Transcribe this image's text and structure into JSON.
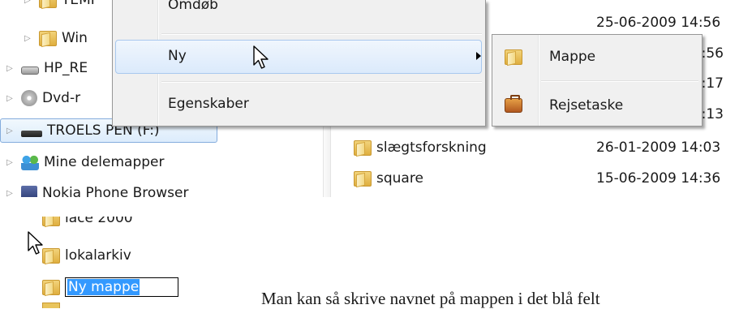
{
  "tree": {
    "items": [
      {
        "label": "TEMP",
        "icon": "folder-icon",
        "level": 2
      },
      {
        "label": "Win",
        "icon": "folder-icon",
        "level": 2
      },
      {
        "label": "HP_RE",
        "icon": "drive-icon",
        "level": 1
      },
      {
        "label": "Dvd-r",
        "icon": "dvd-drive-icon",
        "level": 1
      },
      {
        "label": "TROELS PEN (F:)",
        "icon": "usb-drive-icon",
        "level": 1,
        "selected": true
      },
      {
        "label": "Mine delemapper",
        "icon": "shared-folders-icon",
        "level": 1
      },
      {
        "label": "Nokia Phone Browser",
        "icon": "phone-icon",
        "level": 1
      }
    ]
  },
  "context_menu": {
    "items": [
      {
        "label": "Omdøb"
      },
      {
        "label": "Ny",
        "has_submenu": true,
        "highlighted": true
      },
      {
        "label": "Egenskaber"
      }
    ]
  },
  "submenu": {
    "items": [
      {
        "label": "Mappe",
        "icon": "folder-icon"
      },
      {
        "label": "Rejsetaske",
        "icon": "briefcase-icon"
      }
    ]
  },
  "file_list": {
    "rows": [
      {
        "date": "25-06-2009 14:56"
      },
      {
        "date": "10:56"
      },
      {
        "date": "20:17"
      },
      {
        "date": "15:13"
      },
      {
        "name": "slægtsforskning",
        "date": "26-01-2009 14:03"
      },
      {
        "name": "square",
        "date": "15-06-2009 14:36"
      }
    ]
  },
  "rename_view": {
    "items": [
      {
        "label": "lace 2000"
      },
      {
        "label": "lokalarkiv"
      }
    ],
    "rename_value": "Ny mappe"
  },
  "caption": "Man kan så skrive navnet på mappen i det blå felt"
}
